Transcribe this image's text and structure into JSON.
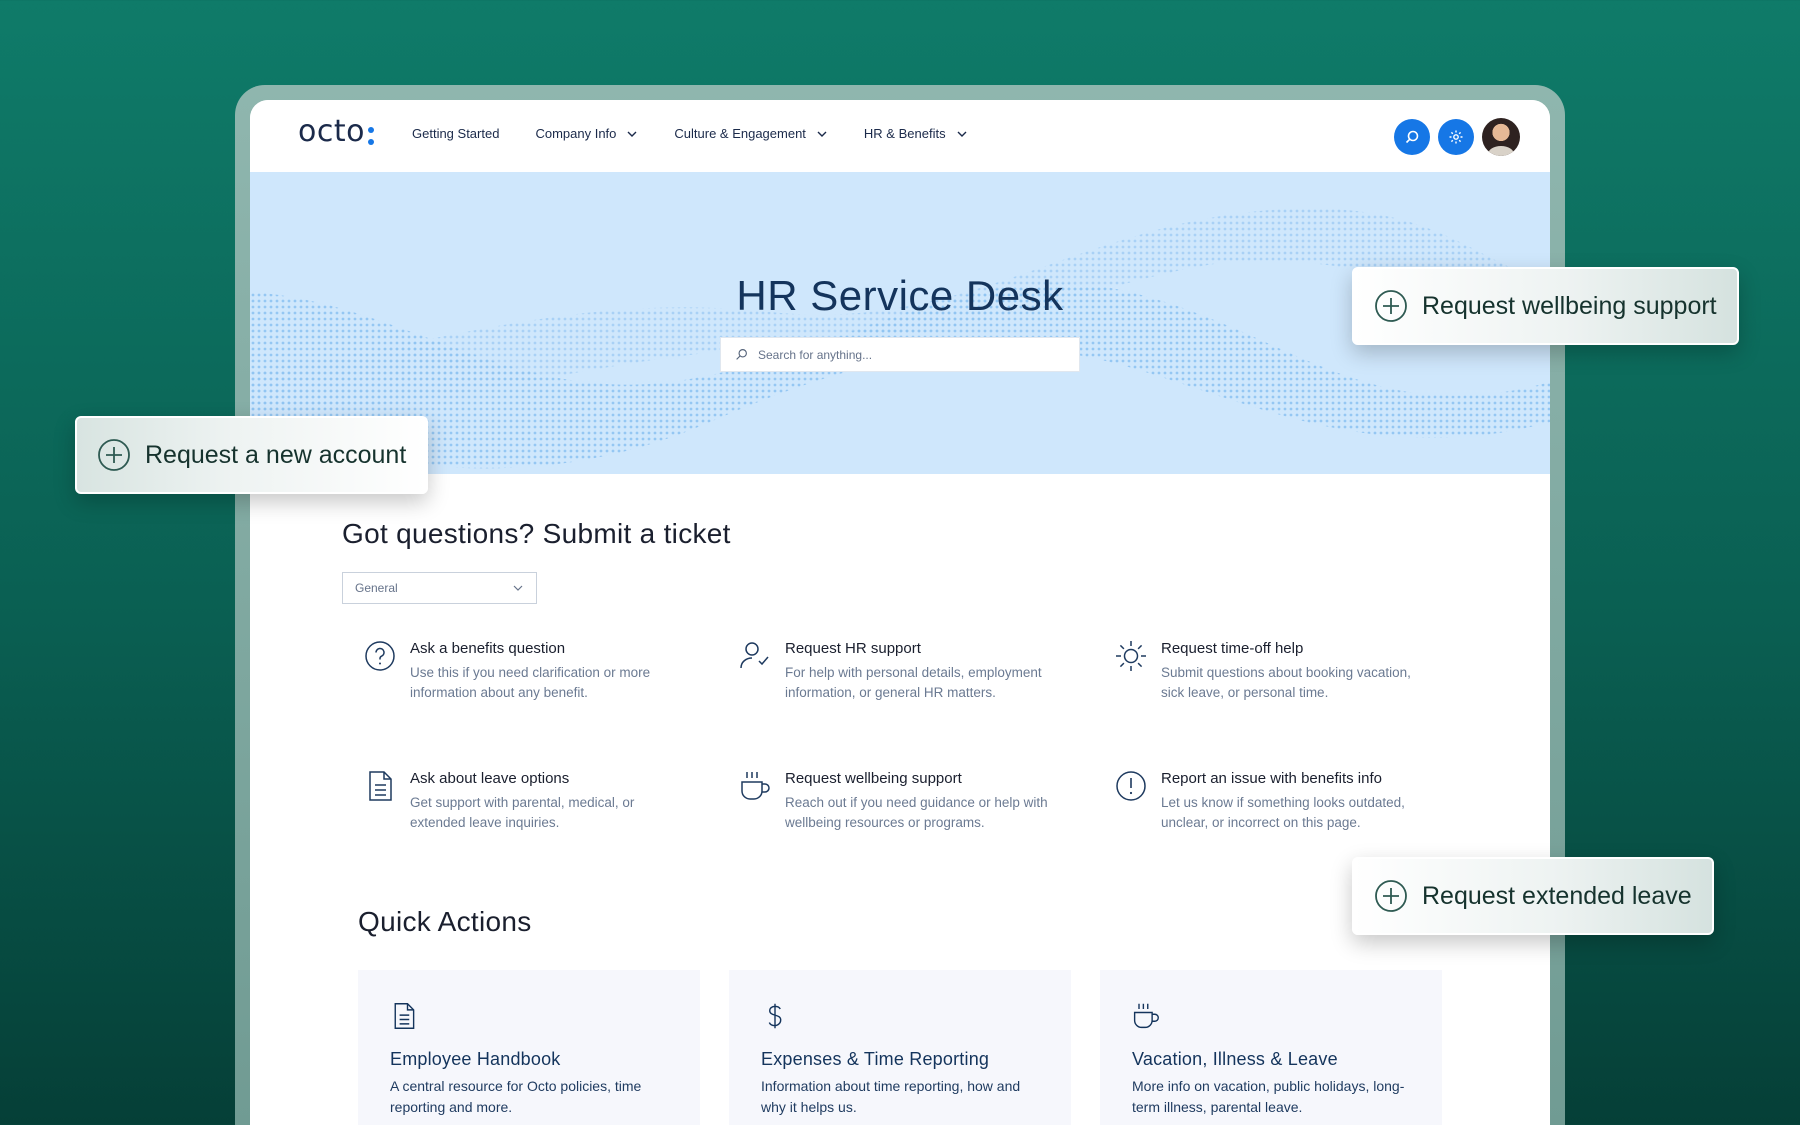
{
  "nav": {
    "logo": "octo",
    "links": [
      {
        "label": "Getting Started",
        "dropdown": false
      },
      {
        "label": "Company Info",
        "dropdown": true
      },
      {
        "label": "Culture & Engagement",
        "dropdown": true
      },
      {
        "label": "HR & Benefits",
        "dropdown": true
      }
    ],
    "right_icons": [
      "search-icon",
      "gear-icon",
      "avatar"
    ]
  },
  "hero": {
    "title": "HR Service Desk",
    "search_placeholder": "Search for anything..."
  },
  "tickets": {
    "title": "Got questions? Submit a ticket",
    "category_selected": "General",
    "items": [
      {
        "icon": "question-circle-icon",
        "title": "Ask a benefits question",
        "description": "Use this if you need clarification or more information about any benefit."
      },
      {
        "icon": "user-check-icon",
        "title": "Request HR support",
        "description": "For help with personal details, employment information, or general HR matters."
      },
      {
        "icon": "sun-icon",
        "title": "Request time-off help",
        "description": "Submit questions about booking vacation, sick leave, or personal time."
      },
      {
        "icon": "document-icon",
        "title": "Ask about leave options",
        "description": "Get support with parental, medical, or extended leave inquiries."
      },
      {
        "icon": "coffee-cup-icon",
        "title": "Request wellbeing support",
        "description": "Reach out if you need guidance or help with wellbeing resources or programs."
      },
      {
        "icon": "exclamation-circle-icon",
        "title": "Report an issue with benefits info",
        "description": "Let us know if something looks outdated, unclear, or incorrect on this page."
      }
    ]
  },
  "quick_actions": {
    "title": "Quick Actions",
    "items": [
      {
        "icon": "document-icon",
        "title": "Employee Handbook",
        "description": "A central resource for Octo policies, time reporting and more."
      },
      {
        "icon": "dollar-icon",
        "title": "Expenses & Time Reporting",
        "description": "Information about time reporting, how and why it helps us."
      },
      {
        "icon": "coffee-cup-icon",
        "title": "Vacation, Illness & Leave",
        "description": "More info on vacation, public holidays, long-term illness, parental leave."
      }
    ]
  },
  "chips": {
    "wellbeing": "Request wellbeing support",
    "new_account": "Request a new account",
    "extended_leave": "Request extended leave"
  },
  "colors": {
    "background": "#0a5f52",
    "accent": "#1677e6",
    "hero": "#cfe7fc",
    "text_dark": "#1a1f2e",
    "text_muted": "#6b7a92"
  }
}
